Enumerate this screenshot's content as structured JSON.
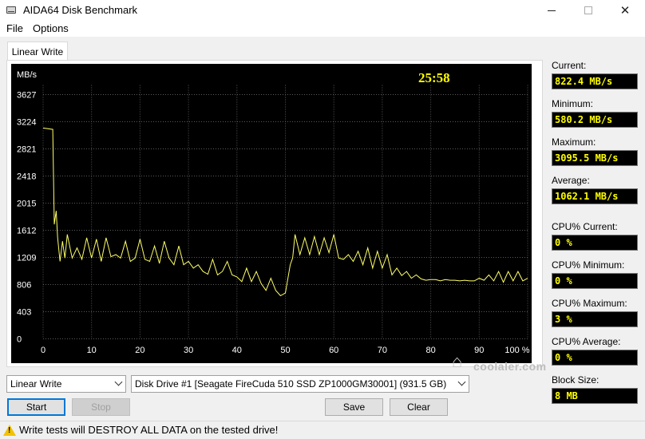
{
  "window": {
    "title": "AIDA64 Disk Benchmark"
  },
  "menu": {
    "file": "File",
    "options": "Options"
  },
  "tab": {
    "label": "Linear Write"
  },
  "chart_data": {
    "type": "line",
    "title": "",
    "timer": "25:58",
    "ylabel": "MB/s",
    "xlabel": "",
    "y_ticks": [
      "3627",
      "3224",
      "2821",
      "2418",
      "2015",
      "1612",
      "1209",
      "806",
      "403",
      "0"
    ],
    "x_ticks": [
      "0",
      "10",
      "20",
      "30",
      "40",
      "50",
      "60",
      "70",
      "80",
      "90",
      "100 %"
    ],
    "xlim": [
      0,
      100
    ],
    "ylim": [
      0,
      3627
    ],
    "grid": true,
    "colors": {
      "background": "#000000",
      "grid": "#5a5a5a",
      "line": "#ffff66",
      "text": "#ffffff",
      "timer": "#ffff00"
    },
    "series": [
      {
        "name": "",
        "x": [
          0,
          2,
          2.3,
          2.7,
          3,
          3.5,
          4,
          4.5,
          5,
          6,
          7,
          8,
          9,
          10,
          11,
          12,
          13,
          14,
          15,
          16,
          17,
          18,
          19,
          20,
          21,
          22,
          23,
          24,
          25,
          26,
          27,
          28,
          29,
          30,
          31,
          32,
          33,
          34,
          35,
          36,
          37,
          38,
          39,
          40,
          41,
          42,
          43,
          44,
          45,
          46,
          47,
          48,
          49,
          50,
          51,
          51.5,
          52,
          53,
          54,
          55,
          56,
          57,
          58,
          59,
          60,
          61,
          62,
          63,
          64,
          65,
          66,
          67,
          68,
          69,
          70,
          71,
          72,
          73,
          74,
          75,
          76,
          77,
          78,
          79,
          80,
          81,
          82,
          83,
          84,
          85,
          86,
          87,
          88,
          89,
          90,
          91,
          92,
          93,
          94,
          95,
          96,
          97,
          98,
          99,
          100
        ],
        "y": [
          3130,
          3110,
          1700,
          1900,
          1500,
          1150,
          1450,
          1200,
          1550,
          1200,
          1350,
          1180,
          1500,
          1200,
          1480,
          1150,
          1500,
          1220,
          1250,
          1200,
          1450,
          1150,
          1200,
          1480,
          1180,
          1150,
          1380,
          1120,
          1450,
          1200,
          1100,
          1380,
          1100,
          1150,
          1050,
          1100,
          1000,
          960,
          1180,
          950,
          1000,
          1150,
          950,
          920,
          850,
          1050,
          850,
          1000,
          820,
          720,
          900,
          720,
          640,
          680,
          1100,
          1200,
          1550,
          1250,
          1500,
          1250,
          1520,
          1250,
          1500,
          1280,
          1550,
          1200,
          1180,
          1250,
          1150,
          1300,
          1100,
          1350,
          1050,
          1300,
          1050,
          1250,
          950,
          1050,
          940,
          1000,
          900,
          950,
          890,
          870,
          880,
          880,
          860,
          880,
          870,
          870,
          860,
          870,
          860,
          860,
          900,
          870,
          950,
          860,
          1000,
          840,
          1000,
          860,
          1000,
          860,
          900
        ]
      }
    ]
  },
  "stats": {
    "current_label": "Current:",
    "current_value": "822.4 MB/s",
    "minimum_label": "Minimum:",
    "minimum_value": "580.2 MB/s",
    "maximum_label": "Maximum:",
    "maximum_value": "3095.5 MB/s",
    "average_label": "Average:",
    "average_value": "1062.1 MB/s",
    "cpu_current_label": "CPU% Current:",
    "cpu_current_value": "0 %",
    "cpu_minimum_label": "CPU% Minimum:",
    "cpu_minimum_value": "0 %",
    "cpu_maximum_label": "CPU% Maximum:",
    "cpu_maximum_value": "3 %",
    "cpu_average_label": "CPU% Average:",
    "cpu_average_value": "0 %",
    "block_size_label": "Block Size:",
    "block_size_value": "8 MB"
  },
  "controls": {
    "test_select": "Linear Write",
    "drive_select": "Disk Drive #1  [Seagate FireCuda 510 SSD ZP1000GM30001]  (931.5 GB)",
    "start": "Start",
    "stop": "Stop",
    "save": "Save",
    "clear": "Clear"
  },
  "watermark": "coolaler.com",
  "status": {
    "warning": "Write tests will DESTROY ALL DATA on the tested drive!"
  }
}
